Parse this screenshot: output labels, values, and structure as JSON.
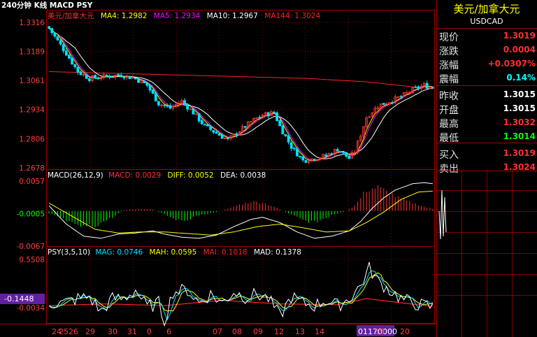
{
  "window": {
    "title": "240分钟 K线 MACD PSY"
  },
  "colors": {
    "up": "#ff3333",
    "down": "#00e0ff",
    "grid": "#800000",
    "axis_text": "#ff4040",
    "ma4": "#ffff00",
    "ma5": "#ff00ff",
    "ma10": "#ffffff",
    "ma144": "#ff2020",
    "macd_pos": "#ff3030",
    "macd_neg": "#00ff00",
    "diff": "#ffffff",
    "dea": "#ffff00",
    "psy": "#ffffff",
    "mag": "#00e0ff",
    "mah": "#ffff00",
    "mai": "#ff2020",
    "mad": "#c0c0c0",
    "highlight": "#6020a0"
  },
  "main_legend": {
    "name": "美元/加拿大元",
    "ma4": "MA4: 1.2982",
    "ma5": "MA5: 1.2934",
    "ma10": "MA10: 1.2967",
    "ma144": "MA144: 1.3024"
  },
  "macd_legend": {
    "name": "MACD(26,12,9)",
    "macd": "MACD: 0.0029",
    "diff": "DIFF: 0.0052",
    "dea": "DEA: 0.0038"
  },
  "psy_legend": {
    "name": "PSY(3,5,10)",
    "mag": "MAG: 0.0746",
    "mah": "MAH: 0.0595",
    "mai": "MAI: 0.1018",
    "mad": "MAD: 0.1378"
  },
  "y_axis": {
    "price_ticks": [
      "1.3316",
      "1.3189",
      "1.3061",
      "1.2934",
      "1.2806",
      "1.2678"
    ],
    "macd_ticks": [
      "0.0057",
      "-0.0005",
      "-0.0067"
    ],
    "psy_ticks": [
      "0.5508",
      "-0.0034"
    ],
    "psy_cursor": "-0.1448"
  },
  "x_axis": {
    "labels": [
      "24",
      "25",
      "26",
      "29",
      "30",
      "31",
      "0",
      "6",
      "07",
      "08",
      "09",
      "12",
      "13",
      "14",
      "01170000",
      "19",
      "20"
    ]
  },
  "sidebar": {
    "title": "美元/加拿大元",
    "symbol": "USDCAD",
    "rows": [
      {
        "label": "现价",
        "value": "1.3019",
        "color": "#ff3030"
      },
      {
        "label": "涨跌",
        "value": "0.0004",
        "color": "#ff3030"
      },
      {
        "label": "涨幅",
        "value": "+0.0307%",
        "color": "#ff3030"
      },
      {
        "label": "震幅",
        "value": "0.14%",
        "color": "#00ffff"
      },
      {
        "label": "昨收",
        "value": "1.3015",
        "color": "#ffffff"
      },
      {
        "label": "开盘",
        "value": "1.3015",
        "color": "#ffffff"
      },
      {
        "label": "最高",
        "value": "1.3032",
        "color": "#ff3030"
      },
      {
        "label": "最低",
        "value": "1.3014",
        "color": "#00ff00"
      },
      {
        "label": "买入",
        "value": "1.3019",
        "color": "#ff3030"
      },
      {
        "label": "卖出",
        "value": "1.3024",
        "color": "#ff3030"
      }
    ]
  },
  "chart_data": [
    {
      "type": "candlestick",
      "title": "240分钟 K线",
      "ylim": [
        1.2678,
        1.3316
      ],
      "x_labels": [
        "24",
        "25",
        "26",
        "29",
        "30",
        "31",
        "0",
        "6",
        "07",
        "08",
        "09",
        "12",
        "13",
        "14",
        "01170000",
        "19",
        "20"
      ],
      "anchors_close": [
        [
          0,
          1.329
        ],
        [
          6,
          1.318
        ],
        [
          10,
          1.31
        ],
        [
          14,
          1.307
        ],
        [
          20,
          1.308
        ],
        [
          25,
          1.3085
        ],
        [
          30,
          1.307
        ],
        [
          34,
          1.304
        ],
        [
          38,
          1.296
        ],
        [
          42,
          1.294
        ],
        [
          46,
          1.297
        ],
        [
          50,
          1.292
        ],
        [
          54,
          1.286
        ],
        [
          58,
          1.283
        ],
        [
          62,
          1.28
        ],
        [
          66,
          1.284
        ],
        [
          70,
          1.288
        ],
        [
          74,
          1.291
        ],
        [
          78,
          1.292
        ],
        [
          80,
          1.286
        ],
        [
          84,
          1.277
        ],
        [
          88,
          1.271
        ],
        [
          92,
          1.272
        ],
        [
          96,
          1.273
        ],
        [
          100,
          1.276
        ],
        [
          104,
          1.272
        ],
        [
          106,
          1.275
        ],
        [
          110,
          1.29
        ],
        [
          114,
          1.295
        ],
        [
          118,
          1.297
        ],
        [
          122,
          1.299
        ],
        [
          126,
          1.302
        ],
        [
          130,
          1.304
        ],
        [
          133,
          1.303
        ]
      ],
      "ma144_anchors": [
        [
          0,
          1.31
        ],
        [
          30,
          1.309
        ],
        [
          60,
          1.308
        ],
        [
          90,
          1.307
        ],
        [
          110,
          1.3055
        ],
        [
          133,
          1.3024
        ]
      ]
    },
    {
      "type": "bar+line",
      "title": "MACD(26,12,9)",
      "ylim": [
        -0.0067,
        0.0057
      ],
      "hist_anchors": [
        [
          0,
          -0.0005
        ],
        [
          3,
          -0.001
        ],
        [
          10,
          -0.003
        ],
        [
          16,
          -0.0028
        ],
        [
          22,
          -0.0012
        ],
        [
          26,
          0.0002
        ],
        [
          32,
          0.0004
        ],
        [
          36,
          0.0003
        ],
        [
          40,
          -0.0006
        ],
        [
          46,
          -0.002
        ],
        [
          52,
          -0.0008
        ],
        [
          58,
          -0.0002
        ],
        [
          62,
          0.0004
        ],
        [
          66,
          0.0012
        ],
        [
          70,
          0.0018
        ],
        [
          74,
          0.0016
        ],
        [
          78,
          0.0008
        ],
        [
          82,
          -0.0002
        ],
        [
          86,
          -0.0012
        ],
        [
          90,
          -0.0022
        ],
        [
          94,
          -0.0018
        ],
        [
          98,
          -0.0008
        ],
        [
          102,
          -0.0002
        ],
        [
          106,
          0.001
        ],
        [
          110,
          0.004
        ],
        [
          114,
          0.0045
        ],
        [
          118,
          0.0034
        ],
        [
          122,
          0.0022
        ],
        [
          126,
          0.0016
        ],
        [
          130,
          0.0008
        ],
        [
          133,
          0.0004
        ]
      ],
      "diff_anchors": [
        [
          0,
          0.001
        ],
        [
          6,
          -0.0025
        ],
        [
          12,
          -0.0048
        ],
        [
          18,
          -0.0052
        ],
        [
          24,
          -0.0044
        ],
        [
          30,
          -0.0042
        ],
        [
          36,
          -0.0038
        ],
        [
          40,
          -0.0044
        ],
        [
          46,
          -0.005
        ],
        [
          52,
          -0.0052
        ],
        [
          58,
          -0.0046
        ],
        [
          64,
          -0.003
        ],
        [
          70,
          -0.0016
        ],
        [
          74,
          -0.0012
        ],
        [
          80,
          -0.0022
        ],
        [
          86,
          -0.004
        ],
        [
          92,
          -0.0052
        ],
        [
          98,
          -0.0048
        ],
        [
          104,
          -0.0038
        ],
        [
          108,
          -0.002
        ],
        [
          112,
          0.0005
        ],
        [
          116,
          0.0025
        ],
        [
          120,
          0.004
        ],
        [
          126,
          0.0052
        ],
        [
          130,
          0.0054
        ],
        [
          133,
          0.0052
        ]
      ],
      "dea_anchors": [
        [
          0,
          0.0015
        ],
        [
          8,
          -0.001
        ],
        [
          16,
          -0.0035
        ],
        [
          24,
          -0.0042
        ],
        [
          32,
          -0.004
        ],
        [
          40,
          -0.004
        ],
        [
          48,
          -0.0043
        ],
        [
          56,
          -0.0046
        ],
        [
          64,
          -0.004
        ],
        [
          72,
          -0.003
        ],
        [
          80,
          -0.0025
        ],
        [
          88,
          -0.0032
        ],
        [
          96,
          -0.004
        ],
        [
          104,
          -0.0038
        ],
        [
          110,
          -0.0022
        ],
        [
          116,
          -0.0002
        ],
        [
          122,
          0.0022
        ],
        [
          128,
          0.0036
        ],
        [
          133,
          0.0038
        ]
      ]
    },
    {
      "type": "line",
      "title": "PSY(3,5,10)",
      "ylim": [
        -0.18,
        0.5508
      ],
      "psy_anchors": [
        [
          0,
          0.05
        ],
        [
          5,
          0.05
        ],
        [
          10,
          0.1
        ],
        [
          14,
          0.12
        ],
        [
          18,
          -0.05
        ],
        [
          22,
          0.1
        ],
        [
          26,
          0.1
        ],
        [
          30,
          0.2
        ],
        [
          34,
          0.0
        ],
        [
          38,
          0.05
        ],
        [
          40,
          -0.15
        ],
        [
          43,
          0.18
        ],
        [
          48,
          0.2
        ],
        [
          52,
          0.05
        ],
        [
          56,
          0.15
        ],
        [
          60,
          0.05
        ],
        [
          64,
          0.18
        ],
        [
          68,
          0.12
        ],
        [
          72,
          0.15
        ],
        [
          76,
          0.1
        ],
        [
          80,
          -0.1
        ],
        [
          84,
          0.12
        ],
        [
          88,
          0.05
        ],
        [
          92,
          0.02
        ],
        [
          96,
          0.08
        ],
        [
          100,
          0.02
        ],
        [
          104,
          0.1
        ],
        [
          108,
          0.25
        ],
        [
          111,
          0.45
        ],
        [
          114,
          0.3
        ],
        [
          118,
          0.2
        ],
        [
          122,
          0.1
        ],
        [
          126,
          0.05
        ],
        [
          130,
          0.02
        ],
        [
          133,
          0.0
        ]
      ],
      "mai_anchors": [
        [
          0,
          0.02
        ],
        [
          20,
          0.04
        ],
        [
          40,
          0.02
        ],
        [
          60,
          0.08
        ],
        [
          80,
          0.04
        ],
        [
          100,
          0.03
        ],
        [
          110,
          0.1
        ],
        [
          120,
          0.06
        ],
        [
          133,
          0.01
        ]
      ]
    }
  ]
}
